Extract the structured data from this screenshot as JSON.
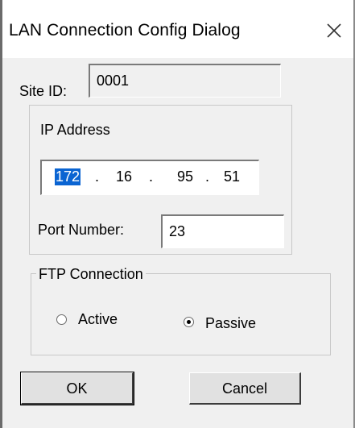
{
  "window": {
    "title": "LAN Connection Config Dialog"
  },
  "site": {
    "label": "Site ID:",
    "value": "0001"
  },
  "ip_group": {
    "title": "IP Address",
    "octets": [
      "172",
      "16",
      "95",
      "51"
    ],
    "separator": ".",
    "selected_octet_index": 0,
    "port_label": "Port Number:",
    "port_value": "23"
  },
  "ftp_group": {
    "title": "FTP Connection",
    "options": [
      {
        "label": "Active",
        "selected": false
      },
      {
        "label": "Passive",
        "selected": true
      }
    ]
  },
  "buttons": {
    "ok": "OK",
    "cancel": "Cancel"
  },
  "colors": {
    "selection": "#0a64d2",
    "dialog_bg": "#f0f0f0"
  }
}
